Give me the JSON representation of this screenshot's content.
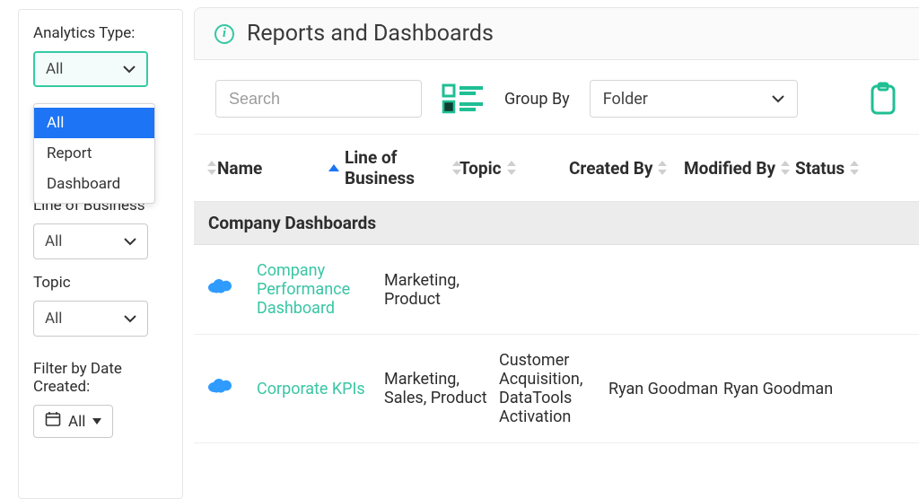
{
  "sidebar": {
    "analytics_type_label": "Analytics Type:",
    "analytics_type_value": "All",
    "analytics_type_options": [
      "All",
      "Report",
      "Dashboard"
    ],
    "lob_label": "Line of Business",
    "lob_value": "All",
    "topic_label": "Topic",
    "topic_value": "All",
    "date_label": "Filter by Date Created:",
    "date_value": "All"
  },
  "header": {
    "title": "Reports and Dashboards"
  },
  "toolbar": {
    "search_placeholder": "Search",
    "groupby_label": "Group By",
    "groupby_value": "Folder"
  },
  "table": {
    "columns": {
      "name": "Name",
      "lob": "Line of Business",
      "topic": "Topic",
      "created_by": "Created By",
      "modified_by": "Modified By",
      "status": "Status"
    },
    "group": "Company Dashboards",
    "rows": [
      {
        "name": "Company Performance Dashboard",
        "lob": "Marketing, Product",
        "topic": "",
        "created_by": "",
        "modified_by": ""
      },
      {
        "name": "Corporate KPIs",
        "lob": "Marketing, Sales, Product",
        "topic": "Customer Acquisition, DataTools Activation",
        "created_by": "Ryan Goodman",
        "modified_by": "Ryan Goodman"
      }
    ]
  }
}
